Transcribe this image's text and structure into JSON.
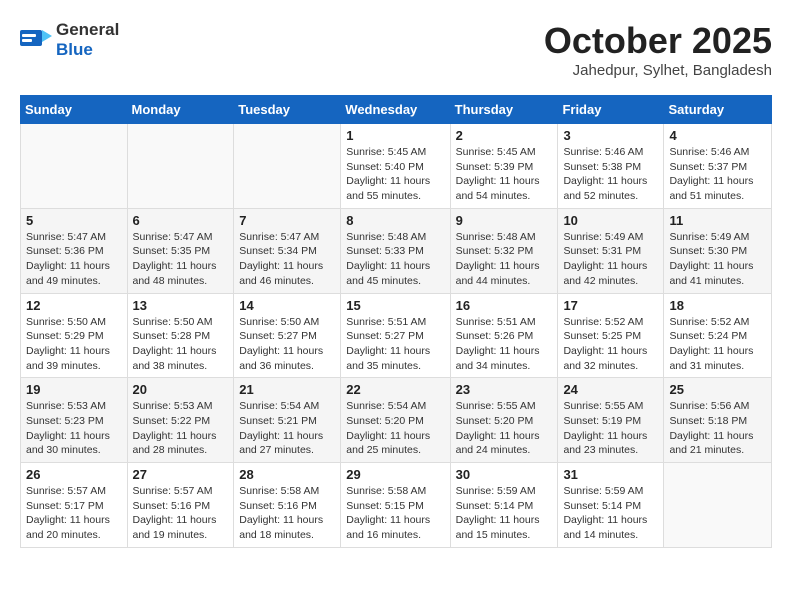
{
  "header": {
    "logo_general": "General",
    "logo_blue": "Blue",
    "month": "October 2025",
    "location": "Jahedpur, Sylhet, Bangladesh"
  },
  "weekdays": [
    "Sunday",
    "Monday",
    "Tuesday",
    "Wednesday",
    "Thursday",
    "Friday",
    "Saturday"
  ],
  "weeks": [
    [
      {
        "day": "",
        "lines": []
      },
      {
        "day": "",
        "lines": []
      },
      {
        "day": "",
        "lines": []
      },
      {
        "day": "1",
        "lines": [
          "Sunrise: 5:45 AM",
          "Sunset: 5:40 PM",
          "Daylight: 11 hours",
          "and 55 minutes."
        ]
      },
      {
        "day": "2",
        "lines": [
          "Sunrise: 5:45 AM",
          "Sunset: 5:39 PM",
          "Daylight: 11 hours",
          "and 54 minutes."
        ]
      },
      {
        "day": "3",
        "lines": [
          "Sunrise: 5:46 AM",
          "Sunset: 5:38 PM",
          "Daylight: 11 hours",
          "and 52 minutes."
        ]
      },
      {
        "day": "4",
        "lines": [
          "Sunrise: 5:46 AM",
          "Sunset: 5:37 PM",
          "Daylight: 11 hours",
          "and 51 minutes."
        ]
      }
    ],
    [
      {
        "day": "5",
        "lines": [
          "Sunrise: 5:47 AM",
          "Sunset: 5:36 PM",
          "Daylight: 11 hours",
          "and 49 minutes."
        ]
      },
      {
        "day": "6",
        "lines": [
          "Sunrise: 5:47 AM",
          "Sunset: 5:35 PM",
          "Daylight: 11 hours",
          "and 48 minutes."
        ]
      },
      {
        "day": "7",
        "lines": [
          "Sunrise: 5:47 AM",
          "Sunset: 5:34 PM",
          "Daylight: 11 hours",
          "and 46 minutes."
        ]
      },
      {
        "day": "8",
        "lines": [
          "Sunrise: 5:48 AM",
          "Sunset: 5:33 PM",
          "Daylight: 11 hours",
          "and 45 minutes."
        ]
      },
      {
        "day": "9",
        "lines": [
          "Sunrise: 5:48 AM",
          "Sunset: 5:32 PM",
          "Daylight: 11 hours",
          "and 44 minutes."
        ]
      },
      {
        "day": "10",
        "lines": [
          "Sunrise: 5:49 AM",
          "Sunset: 5:31 PM",
          "Daylight: 11 hours",
          "and 42 minutes."
        ]
      },
      {
        "day": "11",
        "lines": [
          "Sunrise: 5:49 AM",
          "Sunset: 5:30 PM",
          "Daylight: 11 hours",
          "and 41 minutes."
        ]
      }
    ],
    [
      {
        "day": "12",
        "lines": [
          "Sunrise: 5:50 AM",
          "Sunset: 5:29 PM",
          "Daylight: 11 hours",
          "and 39 minutes."
        ]
      },
      {
        "day": "13",
        "lines": [
          "Sunrise: 5:50 AM",
          "Sunset: 5:28 PM",
          "Daylight: 11 hours",
          "and 38 minutes."
        ]
      },
      {
        "day": "14",
        "lines": [
          "Sunrise: 5:50 AM",
          "Sunset: 5:27 PM",
          "Daylight: 11 hours",
          "and 36 minutes."
        ]
      },
      {
        "day": "15",
        "lines": [
          "Sunrise: 5:51 AM",
          "Sunset: 5:27 PM",
          "Daylight: 11 hours",
          "and 35 minutes."
        ]
      },
      {
        "day": "16",
        "lines": [
          "Sunrise: 5:51 AM",
          "Sunset: 5:26 PM",
          "Daylight: 11 hours",
          "and 34 minutes."
        ]
      },
      {
        "day": "17",
        "lines": [
          "Sunrise: 5:52 AM",
          "Sunset: 5:25 PM",
          "Daylight: 11 hours",
          "and 32 minutes."
        ]
      },
      {
        "day": "18",
        "lines": [
          "Sunrise: 5:52 AM",
          "Sunset: 5:24 PM",
          "Daylight: 11 hours",
          "and 31 minutes."
        ]
      }
    ],
    [
      {
        "day": "19",
        "lines": [
          "Sunrise: 5:53 AM",
          "Sunset: 5:23 PM",
          "Daylight: 11 hours",
          "and 30 minutes."
        ]
      },
      {
        "day": "20",
        "lines": [
          "Sunrise: 5:53 AM",
          "Sunset: 5:22 PM",
          "Daylight: 11 hours",
          "and 28 minutes."
        ]
      },
      {
        "day": "21",
        "lines": [
          "Sunrise: 5:54 AM",
          "Sunset: 5:21 PM",
          "Daylight: 11 hours",
          "and 27 minutes."
        ]
      },
      {
        "day": "22",
        "lines": [
          "Sunrise: 5:54 AM",
          "Sunset: 5:20 PM",
          "Daylight: 11 hours",
          "and 25 minutes."
        ]
      },
      {
        "day": "23",
        "lines": [
          "Sunrise: 5:55 AM",
          "Sunset: 5:20 PM",
          "Daylight: 11 hours",
          "and 24 minutes."
        ]
      },
      {
        "day": "24",
        "lines": [
          "Sunrise: 5:55 AM",
          "Sunset: 5:19 PM",
          "Daylight: 11 hours",
          "and 23 minutes."
        ]
      },
      {
        "day": "25",
        "lines": [
          "Sunrise: 5:56 AM",
          "Sunset: 5:18 PM",
          "Daylight: 11 hours",
          "and 21 minutes."
        ]
      }
    ],
    [
      {
        "day": "26",
        "lines": [
          "Sunrise: 5:57 AM",
          "Sunset: 5:17 PM",
          "Daylight: 11 hours",
          "and 20 minutes."
        ]
      },
      {
        "day": "27",
        "lines": [
          "Sunrise: 5:57 AM",
          "Sunset: 5:16 PM",
          "Daylight: 11 hours",
          "and 19 minutes."
        ]
      },
      {
        "day": "28",
        "lines": [
          "Sunrise: 5:58 AM",
          "Sunset: 5:16 PM",
          "Daylight: 11 hours",
          "and 18 minutes."
        ]
      },
      {
        "day": "29",
        "lines": [
          "Sunrise: 5:58 AM",
          "Sunset: 5:15 PM",
          "Daylight: 11 hours",
          "and 16 minutes."
        ]
      },
      {
        "day": "30",
        "lines": [
          "Sunrise: 5:59 AM",
          "Sunset: 5:14 PM",
          "Daylight: 11 hours",
          "and 15 minutes."
        ]
      },
      {
        "day": "31",
        "lines": [
          "Sunrise: 5:59 AM",
          "Sunset: 5:14 PM",
          "Daylight: 11 hours",
          "and 14 minutes."
        ]
      },
      {
        "day": "",
        "lines": []
      }
    ]
  ]
}
